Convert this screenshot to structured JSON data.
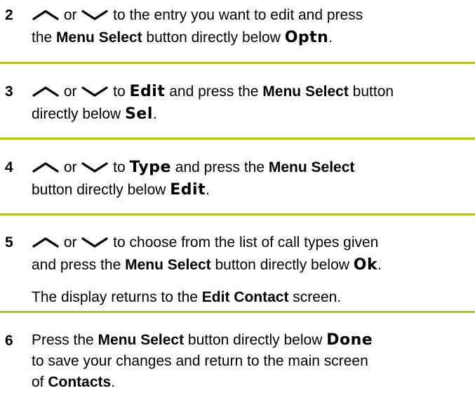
{
  "steps": [
    {
      "number": "2",
      "line1": {
        "or": " or ",
        "to": " to the entry you want to edit and press"
      },
      "line2": {
        "pre": "the ",
        "menu_select": "Menu Select",
        "mid": " button directly below ",
        "softkey": "Optn",
        "post": "."
      }
    },
    {
      "number": "3",
      "line1": {
        "or": " or ",
        "to": " to ",
        "softkey_edit": "Edit",
        "mid": " and press the ",
        "menu_select": "Menu Select",
        "post": " button"
      },
      "line2": {
        "pre": "directly below ",
        "softkey": "Sel",
        "post": "."
      }
    },
    {
      "number": "4",
      "line1": {
        "or": " or ",
        "to": " to ",
        "softkey_type": "Type",
        "mid": " and press the ",
        "menu_select": "Menu Select"
      },
      "line2": {
        "pre": "button directly below ",
        "softkey": "Edit",
        "post": "."
      }
    },
    {
      "number": "5",
      "line1": {
        "or": " or ",
        "to": " to choose from the list of call types given"
      },
      "line2": {
        "pre": "and press the ",
        "menu_select": "Menu Select",
        "mid": " button directly below ",
        "softkey": "Ok",
        "post": "."
      },
      "note": {
        "pre": "The display returns to the ",
        "bold": "Edit Contact",
        "post": " screen."
      }
    },
    {
      "number": "6",
      "line1": {
        "pre": "Press the ",
        "menu_select": "Menu Select",
        "mid": " button directly below ",
        "softkey": "Done"
      },
      "line2": {
        "text": "to save your changes and return to the main screen"
      },
      "line3": {
        "pre": "of ",
        "bold": "Contacts",
        "post": "."
      }
    }
  ],
  "icons": {
    "up": "chevron-up-icon",
    "down": "chevron-down-icon"
  },
  "colors": {
    "rule": "#b5c31b"
  }
}
